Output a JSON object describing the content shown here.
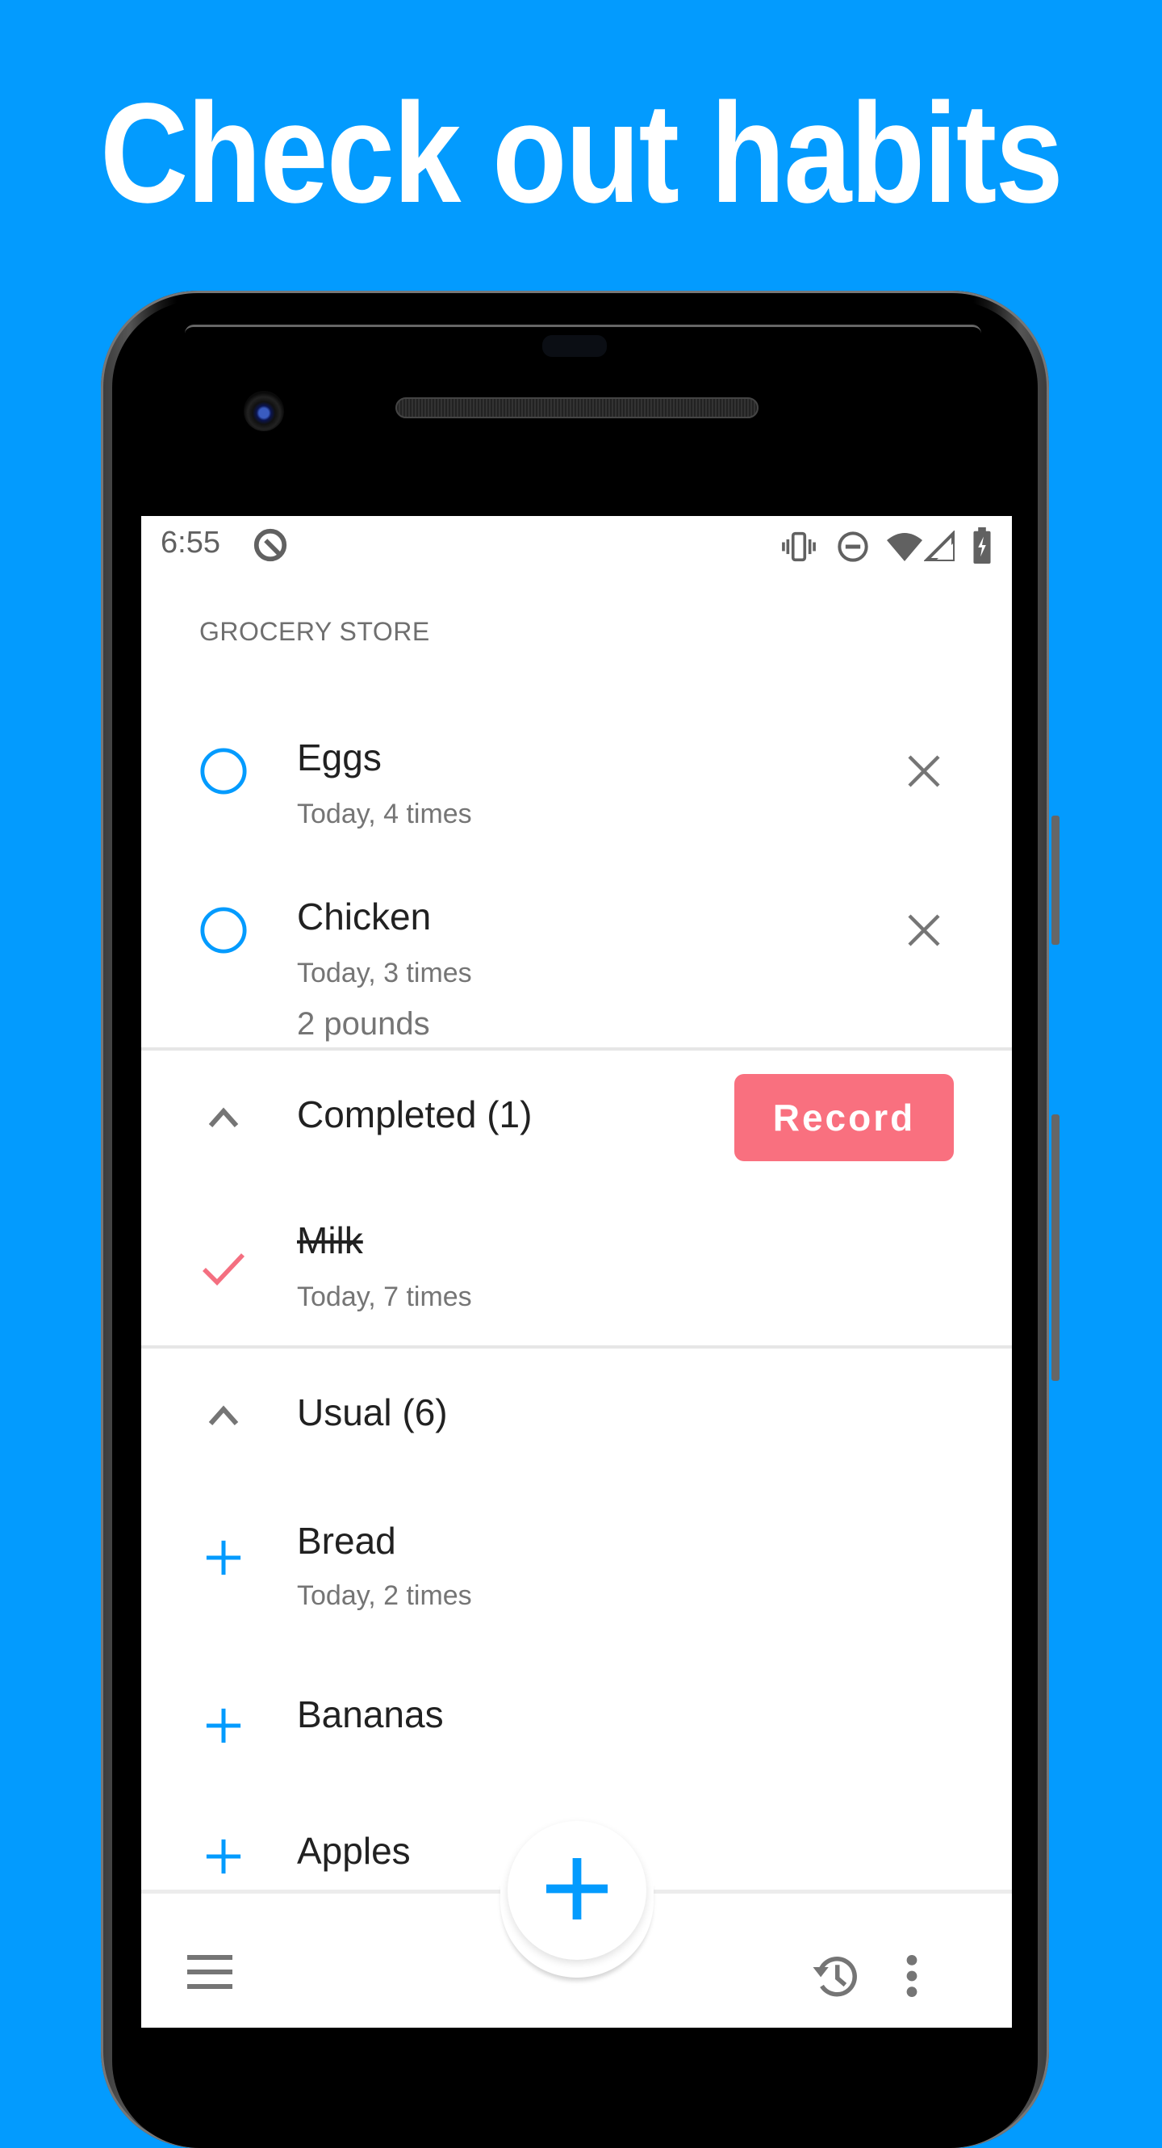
{
  "headline": "Check out habits",
  "colors": {
    "background": "#039BFE",
    "accent_blue": "#039BFE",
    "record_pink": "#F9707F",
    "check_pink": "#F46F80",
    "icon_gray": "#757575"
  },
  "status_bar": {
    "time": "6:55",
    "left_icons": [
      "android-q-icon"
    ],
    "right_icons": [
      "vibrate-icon",
      "do-not-disturb-icon",
      "wifi-icon",
      "cell-signal-icon",
      "battery-charging-icon"
    ]
  },
  "list": {
    "section_header": "GROCERY STORE",
    "active_items": [
      {
        "title": "Eggs",
        "subtitle": "Today, 4 times",
        "note": ""
      },
      {
        "title": "Chicken",
        "subtitle": "Today, 3 times",
        "note": "2 pounds"
      }
    ],
    "completed": {
      "header": "Completed (1)",
      "record_label": "Record",
      "items": [
        {
          "title": "Milk",
          "subtitle": "Today, 7 times"
        }
      ]
    },
    "usual": {
      "header": "Usual (6)",
      "items": [
        {
          "title": "Bread",
          "subtitle": "Today, 2 times"
        },
        {
          "title": "Bananas",
          "subtitle": ""
        },
        {
          "title": "Apples",
          "subtitle": ""
        }
      ]
    }
  },
  "bottom_bar": {
    "icons": [
      "menu-icon",
      "add-icon",
      "history-icon",
      "more-vert-icon"
    ]
  }
}
